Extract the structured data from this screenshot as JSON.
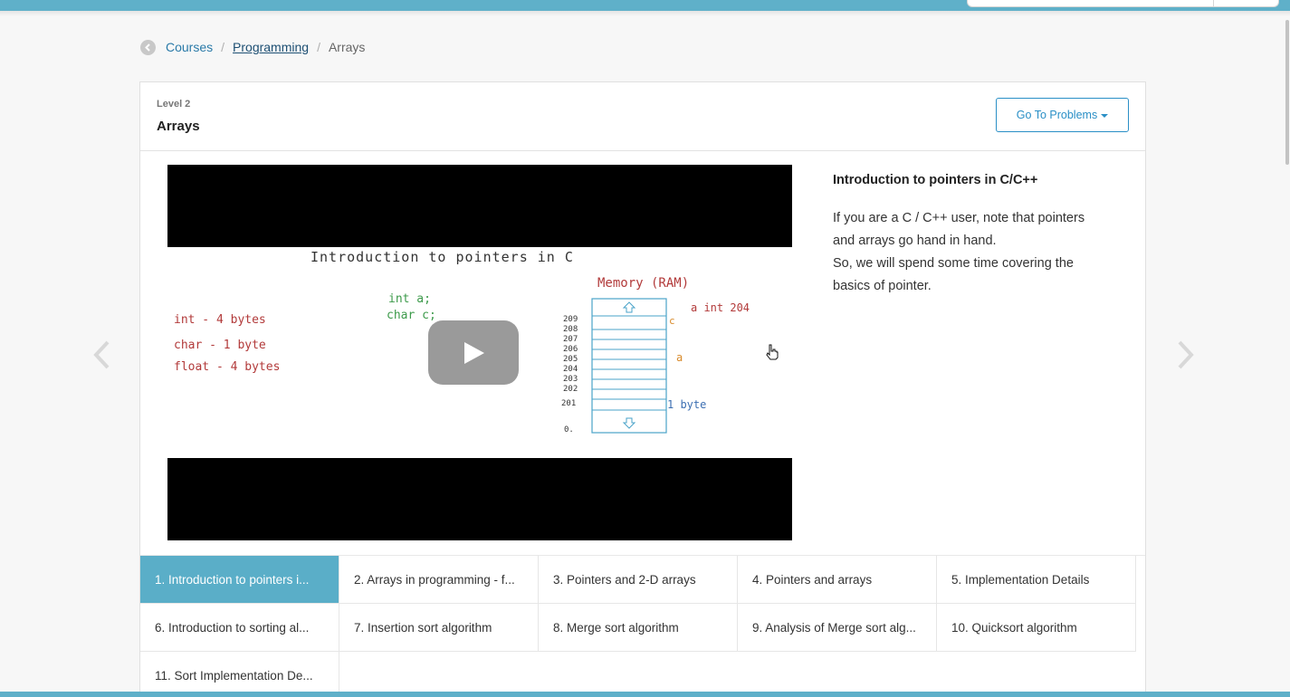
{
  "breadcrumb": {
    "items": [
      "Courses",
      "Programming",
      "Arrays"
    ],
    "separator": "/"
  },
  "header": {
    "level": "Level 2",
    "title": "Arrays",
    "problems_button": "Go To Problems"
  },
  "video": {
    "title": "Introduction to pointers in C",
    "sizes": [
      "int - 4 bytes",
      "char - 1 byte",
      "float - 4 bytes"
    ],
    "decl": [
      "int a;",
      "char c;"
    ],
    "memory_label": "Memory (RAM)",
    "addresses": [
      "209",
      "208",
      "207",
      "206",
      "205",
      "204",
      "203",
      "202",
      "201",
      "0."
    ],
    "var_c": "c",
    "var_a_note": "a int 204",
    "var_a": "a",
    "byte_note": "1 byte"
  },
  "description": {
    "title": "Introduction to pointers in C/C++",
    "lines": [
      "If you are a C / C++ user, note that pointers",
      "and arrays go hand in hand.",
      "So, we will spend some time covering the",
      "basics of pointer."
    ]
  },
  "tabs": [
    "1. Introduction to pointers i...",
    "2. Arrays in programming - f...",
    "3. Pointers and 2-D arrays",
    "4. Pointers and arrays",
    "5. Implementation Details",
    "6. Introduction to sorting al...",
    "7. Insertion sort algorithm",
    "8. Merge sort algorithm",
    "9. Analysis of Merge sort alg...",
    "10. Quicksort algorithm",
    "11. Sort Implementation De..."
  ],
  "active_tab_index": 0,
  "colors": {
    "accent": "#5fb0c9",
    "active_tab": "#5aaec8",
    "link": "#2a7aa8",
    "button": "#2a8fc6"
  },
  "icons": {
    "back": "back-arrow-icon",
    "prev": "chevron-left-icon",
    "next": "chevron-right-icon",
    "play": "play-icon",
    "caret": "caret-down-icon",
    "cursor": "hand-cursor-icon"
  }
}
